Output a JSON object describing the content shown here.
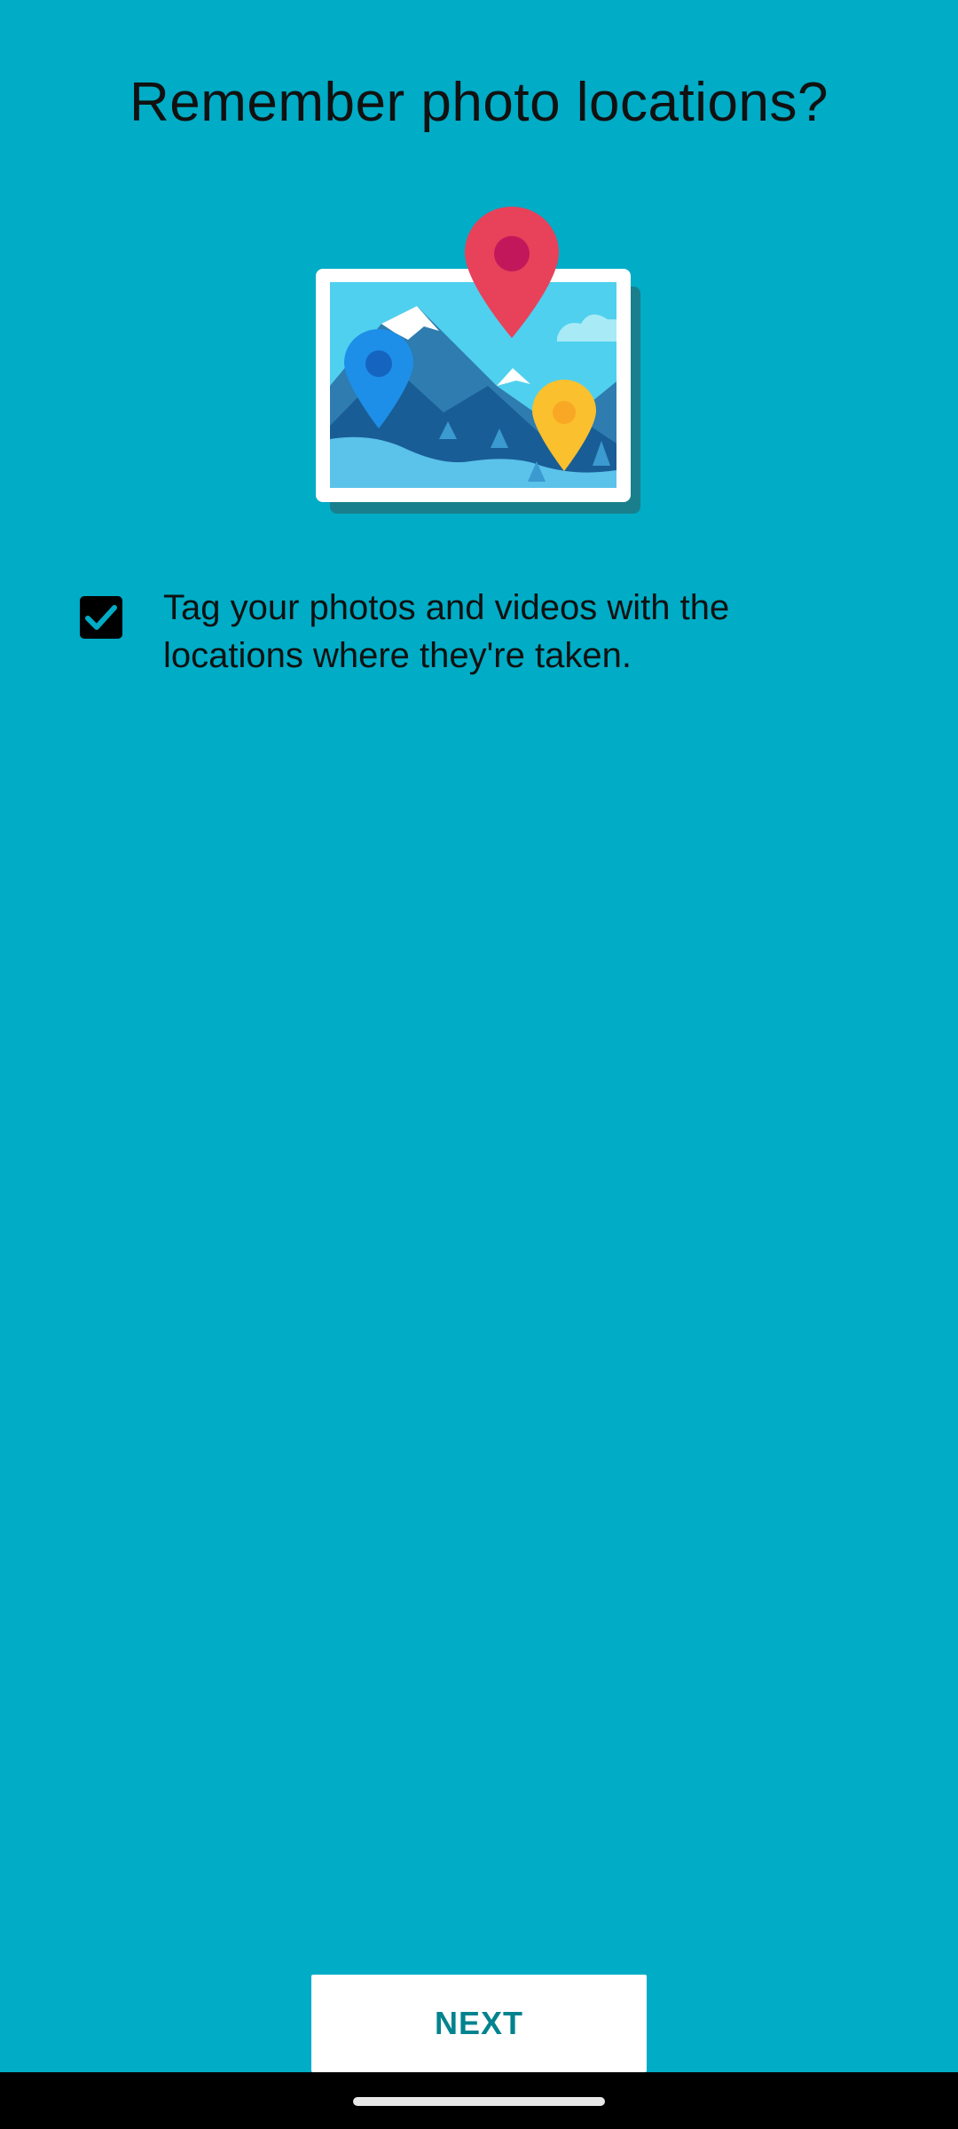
{
  "page": {
    "title": "Remember photo locations?"
  },
  "illustration": {
    "icon": "photo-with-location-pins-illustration"
  },
  "option": {
    "checked": true,
    "text": "Tag your photos and videos with the locations where they're taken."
  },
  "actions": {
    "next_label": "NEXT"
  },
  "colors": {
    "background": "#00ACC6",
    "button_text": "#00838F",
    "pin_red": "#E8415A",
    "pin_blue": "#1E8FE8",
    "pin_yellow": "#FBC02D"
  }
}
